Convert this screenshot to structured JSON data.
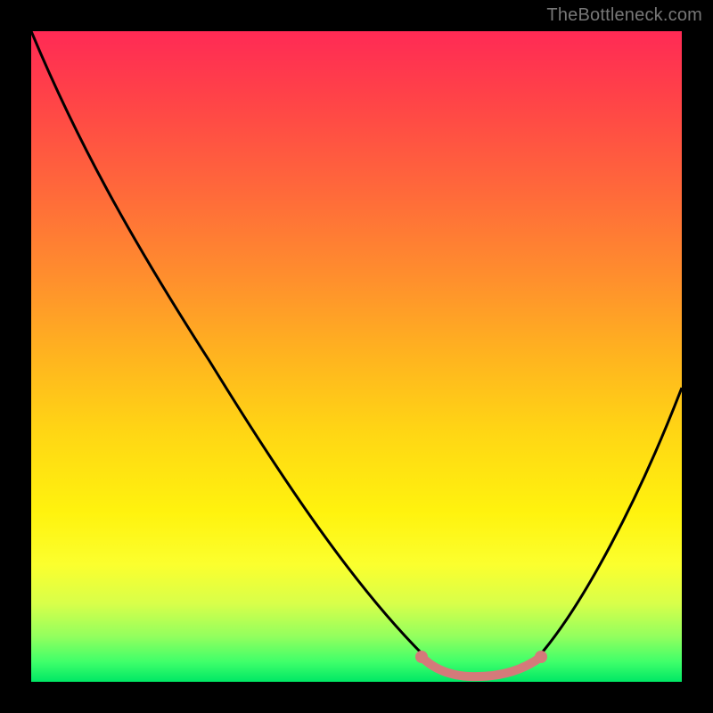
{
  "watermark": "TheBottleneck.com",
  "chart_data": {
    "type": "line",
    "title": "",
    "xlabel": "",
    "ylabel": "",
    "xlim": [
      0,
      100
    ],
    "ylim": [
      0,
      100
    ],
    "grid": false,
    "series": [
      {
        "name": "bottleneck-curve",
        "x": [
          0,
          10,
          20,
          30,
          40,
          50,
          60,
          63,
          70,
          77,
          80,
          88,
          100
        ],
        "values": [
          100,
          85,
          70,
          55,
          40,
          25,
          10,
          3,
          1,
          3,
          10,
          25,
          50
        ],
        "stroke": "#000000"
      },
      {
        "name": "sweet-spot-band",
        "x": [
          60,
          63,
          66,
          70,
          74,
          77,
          80
        ],
        "values": [
          3.5,
          2.5,
          2.0,
          1.8,
          2.0,
          2.5,
          3.5
        ],
        "stroke": "#d47a7a"
      }
    ],
    "markers": [
      {
        "name": "sweet-spot-left",
        "x": 60.5,
        "y": 3.5,
        "color": "#d47a7a"
      },
      {
        "name": "sweet-spot-right",
        "x": 79.5,
        "y": 3.5,
        "color": "#d47a7a"
      }
    ],
    "background_gradient": {
      "top": "#ff2a55",
      "bottom": "#00e765"
    }
  }
}
